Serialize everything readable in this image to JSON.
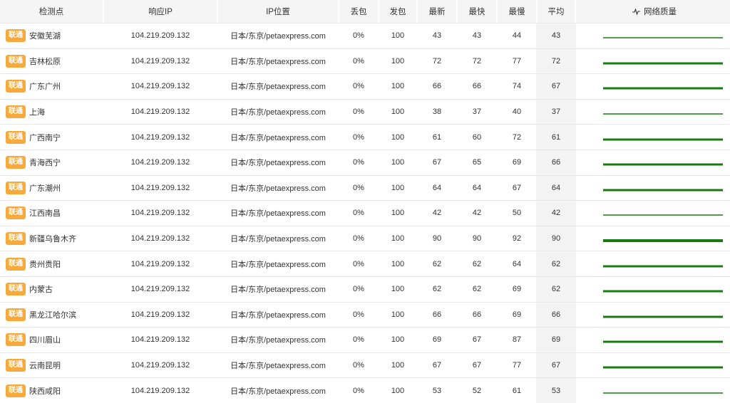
{
  "header": {
    "point": "检测点",
    "ip": "响应IP",
    "location": "IP位置",
    "loss": "丢包",
    "sent": "发包",
    "latest": "最新",
    "fastest": "最快",
    "slowest": "最慢",
    "average": "平均",
    "quality": "网络质量"
  },
  "colors": {
    "isp_badge": "#f7a93b",
    "quality_line": "#1a7a12"
  },
  "rows": [
    {
      "isp": "联通",
      "city": "安徽芜湖",
      "ip": "104.219.209.132",
      "location": "日本/东京/petaexpress.com",
      "loss": "0%",
      "sent": "100",
      "latest": "43",
      "fastest": "43",
      "slowest": "44",
      "average": "43",
      "thickness": 1.5
    },
    {
      "isp": "联通",
      "city": "吉林松原",
      "ip": "104.219.209.132",
      "location": "日本/东京/petaexpress.com",
      "loss": "0%",
      "sent": "100",
      "latest": "72",
      "fastest": "72",
      "slowest": "77",
      "average": "72",
      "thickness": 3
    },
    {
      "isp": "联通",
      "city": "广东广州",
      "ip": "104.219.209.132",
      "location": "日本/东京/petaexpress.com",
      "loss": "0%",
      "sent": "100",
      "latest": "66",
      "fastest": "66",
      "slowest": "74",
      "average": "67",
      "thickness": 3
    },
    {
      "isp": "联通",
      "city": "上海",
      "ip": "104.219.209.132",
      "location": "日本/东京/petaexpress.com",
      "loss": "0%",
      "sent": "100",
      "latest": "38",
      "fastest": "37",
      "slowest": "40",
      "average": "37",
      "thickness": 1.5
    },
    {
      "isp": "联通",
      "city": "广西南宁",
      "ip": "104.219.209.132",
      "location": "日本/东京/petaexpress.com",
      "loss": "0%",
      "sent": "100",
      "latest": "61",
      "fastest": "60",
      "slowest": "72",
      "average": "61",
      "thickness": 3
    },
    {
      "isp": "联通",
      "city": "青海西宁",
      "ip": "104.219.209.132",
      "location": "日本/东京/petaexpress.com",
      "loss": "0%",
      "sent": "100",
      "latest": "67",
      "fastest": "65",
      "slowest": "69",
      "average": "66",
      "thickness": 3
    },
    {
      "isp": "联通",
      "city": "广东潮州",
      "ip": "104.219.209.132",
      "location": "日本/东京/petaexpress.com",
      "loss": "0%",
      "sent": "100",
      "latest": "64",
      "fastest": "64",
      "slowest": "67",
      "average": "64",
      "thickness": 3
    },
    {
      "isp": "联通",
      "city": "江西南昌",
      "ip": "104.219.209.132",
      "location": "日本/东京/petaexpress.com",
      "loss": "0%",
      "sent": "100",
      "latest": "42",
      "fastest": "42",
      "slowest": "50",
      "average": "42",
      "thickness": 1.5
    },
    {
      "isp": "联通",
      "city": "新疆乌鲁木齐",
      "ip": "104.219.209.132",
      "location": "日本/东京/petaexpress.com",
      "loss": "0%",
      "sent": "100",
      "latest": "90",
      "fastest": "90",
      "slowest": "92",
      "average": "90",
      "thickness": 4
    },
    {
      "isp": "联通",
      "city": "贵州贵阳",
      "ip": "104.219.209.132",
      "location": "日本/东京/petaexpress.com",
      "loss": "0%",
      "sent": "100",
      "latest": "62",
      "fastest": "62",
      "slowest": "64",
      "average": "62",
      "thickness": 3
    },
    {
      "isp": "联通",
      "city": "内蒙古",
      "ip": "104.219.209.132",
      "location": "日本/东京/petaexpress.com",
      "loss": "0%",
      "sent": "100",
      "latest": "62",
      "fastest": "62",
      "slowest": "69",
      "average": "62",
      "thickness": 3
    },
    {
      "isp": "联通",
      "city": "黑龙江哈尔滨",
      "ip": "104.219.209.132",
      "location": "日本/东京/petaexpress.com",
      "loss": "0%",
      "sent": "100",
      "latest": "66",
      "fastest": "66",
      "slowest": "69",
      "average": "66",
      "thickness": 3
    },
    {
      "isp": "联通",
      "city": "四川眉山",
      "ip": "104.219.209.132",
      "location": "日本/东京/petaexpress.com",
      "loss": "0%",
      "sent": "100",
      "latest": "69",
      "fastest": "67",
      "slowest": "87",
      "average": "69",
      "thickness": 3
    },
    {
      "isp": "联通",
      "city": "云南昆明",
      "ip": "104.219.209.132",
      "location": "日本/东京/petaexpress.com",
      "loss": "0%",
      "sent": "100",
      "latest": "67",
      "fastest": "67",
      "slowest": "77",
      "average": "67",
      "thickness": 3
    },
    {
      "isp": "联通",
      "city": "陕西咸阳",
      "ip": "104.219.209.132",
      "location": "日本/东京/petaexpress.com",
      "loss": "0%",
      "sent": "100",
      "latest": "53",
      "fastest": "52",
      "slowest": "61",
      "average": "53",
      "thickness": 1.5
    }
  ]
}
